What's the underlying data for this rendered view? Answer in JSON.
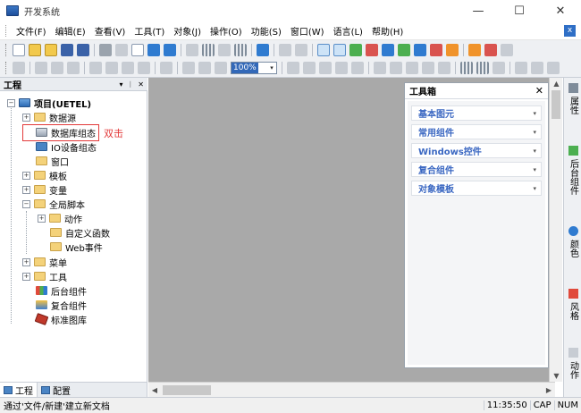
{
  "window": {
    "title": "开发系统",
    "minimize": "—",
    "maximize": "☐",
    "close": "✕"
  },
  "menu": {
    "items": [
      "文件(F)",
      "编辑(E)",
      "查看(V)",
      "工具(T)",
      "对象(J)",
      "操作(O)",
      "功能(S)",
      "窗口(W)",
      "语言(L)",
      "帮助(H)"
    ],
    "close_doc": "x"
  },
  "toolbar": {
    "zoom_value": "100%",
    "zoom_dropdown": "▾"
  },
  "project_panel": {
    "title": "工程",
    "pin": "▾",
    "autohide": "ᛁ",
    "close": "✕",
    "tree": [
      {
        "label": "项目(UETEL)",
        "bold": true
      },
      {
        "label": "数据源"
      },
      {
        "label": "数据库组态"
      },
      {
        "label": "IO设备组态"
      },
      {
        "label": "窗口"
      },
      {
        "label": "模板"
      },
      {
        "label": "变量"
      },
      {
        "label": "全局脚本"
      },
      {
        "label": "动作"
      },
      {
        "label": "自定义函数"
      },
      {
        "label": "Web事件"
      },
      {
        "label": "菜单"
      },
      {
        "label": "工具"
      },
      {
        "label": "后台组件"
      },
      {
        "label": "复合组件"
      },
      {
        "label": "标准图库"
      }
    ],
    "annotation": "双击",
    "tabs": [
      "工程",
      "配置"
    ]
  },
  "toolbox": {
    "title": "工具箱",
    "close": "✕",
    "categories": [
      "基本图元",
      "常用组件",
      "Windows控件",
      "复合组件",
      "对象模板"
    ]
  },
  "right_dock": {
    "tabs": [
      "属性",
      "后台组件",
      "颜色",
      "风格",
      "动作"
    ]
  },
  "statusbar": {
    "message": "通过'文件/新建'建立新文档",
    "time": "11:35:50",
    "caps": "CAP",
    "num": "NUM"
  },
  "colors": {
    "accent": "#3a67c2",
    "highlight_red": "#e23a3a",
    "workarea_gray": "#a9a9a9"
  }
}
